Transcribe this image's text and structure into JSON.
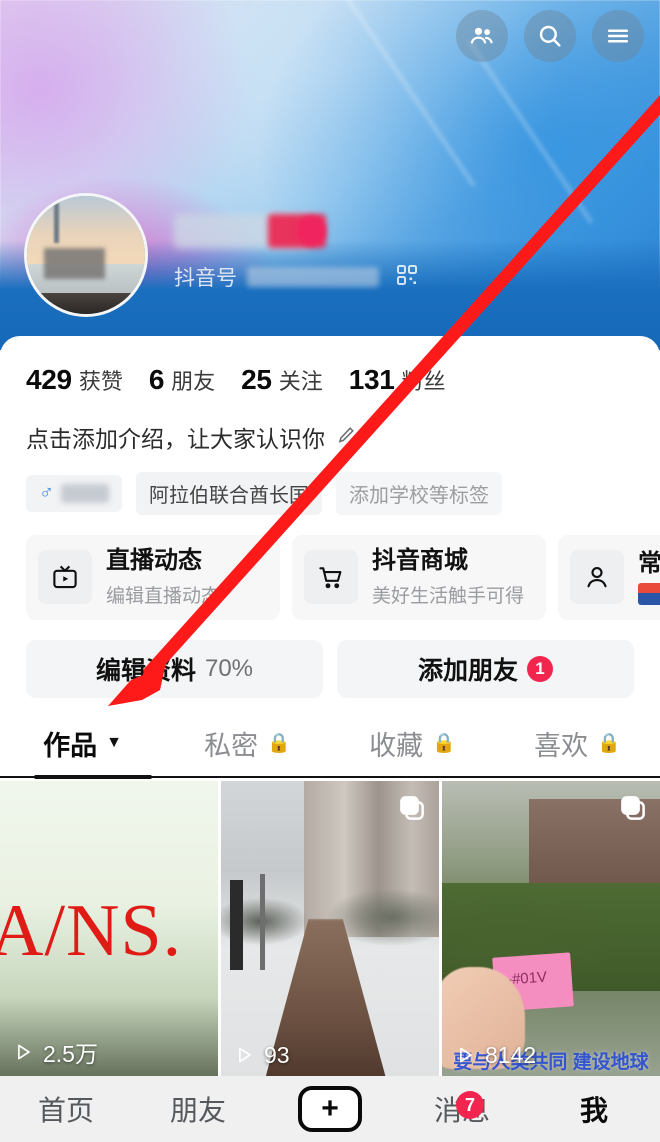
{
  "app": {
    "name": "douyin-profile"
  },
  "header": {
    "icons": [
      {
        "name": "friends-icon",
        "glyph": "people"
      },
      {
        "name": "search-icon",
        "glyph": "magnifier"
      },
      {
        "name": "menu-icon",
        "glyph": "hamburger"
      }
    ]
  },
  "profile": {
    "avatar_alt": "sunset beach photo",
    "name_masked": "",
    "douyin_id_label": "抖音号",
    "douyin_id_masked": "",
    "qr_icon": "qr-code-icon"
  },
  "stats": [
    {
      "num": "429",
      "label": "获赞"
    },
    {
      "num": "6",
      "label": "朋友"
    },
    {
      "num": "25",
      "label": "关注"
    },
    {
      "num": "131",
      "label": "粉丝"
    }
  ],
  "bio": {
    "text": "点击添加介绍，让大家认识你",
    "edit_icon": "pencil-icon"
  },
  "tags": [
    {
      "type": "gender",
      "icon": "male-icon",
      "value": ""
    },
    {
      "type": "location",
      "label": "阿拉伯联合酋长国"
    },
    {
      "type": "add",
      "label": "添加学校等标签"
    }
  ],
  "shortcuts": [
    {
      "icon": "live-tv-icon",
      "title": "直播动态",
      "sub": "编辑直播动态"
    },
    {
      "icon": "cart-icon",
      "title": "抖音商城",
      "sub": "美好生活触手可得"
    },
    {
      "icon": "person-icon",
      "title": "常访",
      "sub": ""
    }
  ],
  "actions": {
    "edit_profile": {
      "label": "编辑资料",
      "percent": "70%"
    },
    "add_friend": {
      "label": "添加朋友",
      "badge": "1"
    }
  },
  "tabs": [
    {
      "label": "作品",
      "active": true,
      "caret": "▼"
    },
    {
      "label": "私密",
      "locked": true
    },
    {
      "label": "收藏",
      "locked": true
    },
    {
      "label": "喜欢",
      "locked": true
    }
  ],
  "videos": [
    {
      "plays": "2.5万",
      "overlay_text": "A/NS.",
      "multi": false
    },
    {
      "plays": "93",
      "overlay_text": "",
      "multi": true
    },
    {
      "plays": "8142",
      "overlay_text": "要与人类共同\n建设地球",
      "multi": true
    }
  ],
  "bottom_nav": [
    {
      "label": "首页",
      "active": false
    },
    {
      "label": "朋友",
      "active": false
    },
    {
      "label": "",
      "icon": "plus-icon",
      "active": false
    },
    {
      "label": "消息",
      "badge": "7",
      "active": false
    },
    {
      "label": "我",
      "active": true
    }
  ],
  "annotation": {
    "arrow_color": "#ff1a1a",
    "box_color": "#ff1a1a",
    "target": "作品"
  }
}
